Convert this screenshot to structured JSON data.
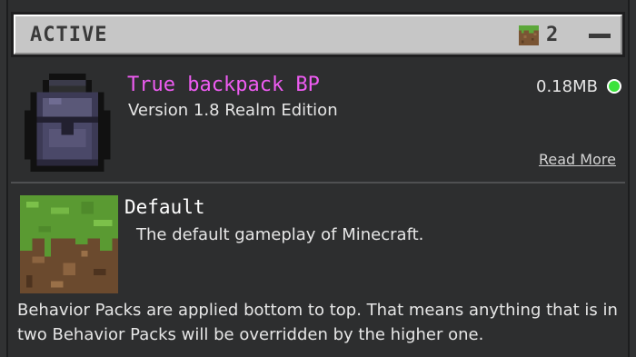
{
  "section": {
    "title": "ACTIVE",
    "count": "2",
    "count_icon": "grass-block-icon",
    "collapse_icon": "minus-icon"
  },
  "packs": [
    {
      "title": "True backpack BP",
      "subtitle": "Version 1.8 Realm Edition",
      "size": "0.18MB",
      "status_color": "#3be33b",
      "read_more": "Read More",
      "icon": "backpack-icon"
    },
    {
      "title": "Default",
      "subtitle": "The default gameplay of Minecraft.",
      "icon": "grass-block-icon"
    }
  ],
  "footer_note": "Behavior Packs are applied bottom to top. That means anything that is in two Behavior Packs will be overridden by the higher one.",
  "colors": {
    "title_accent": "#ee5cf2",
    "header_bg": "#c6c6c6",
    "panel_bg": "#2d2e2f"
  }
}
